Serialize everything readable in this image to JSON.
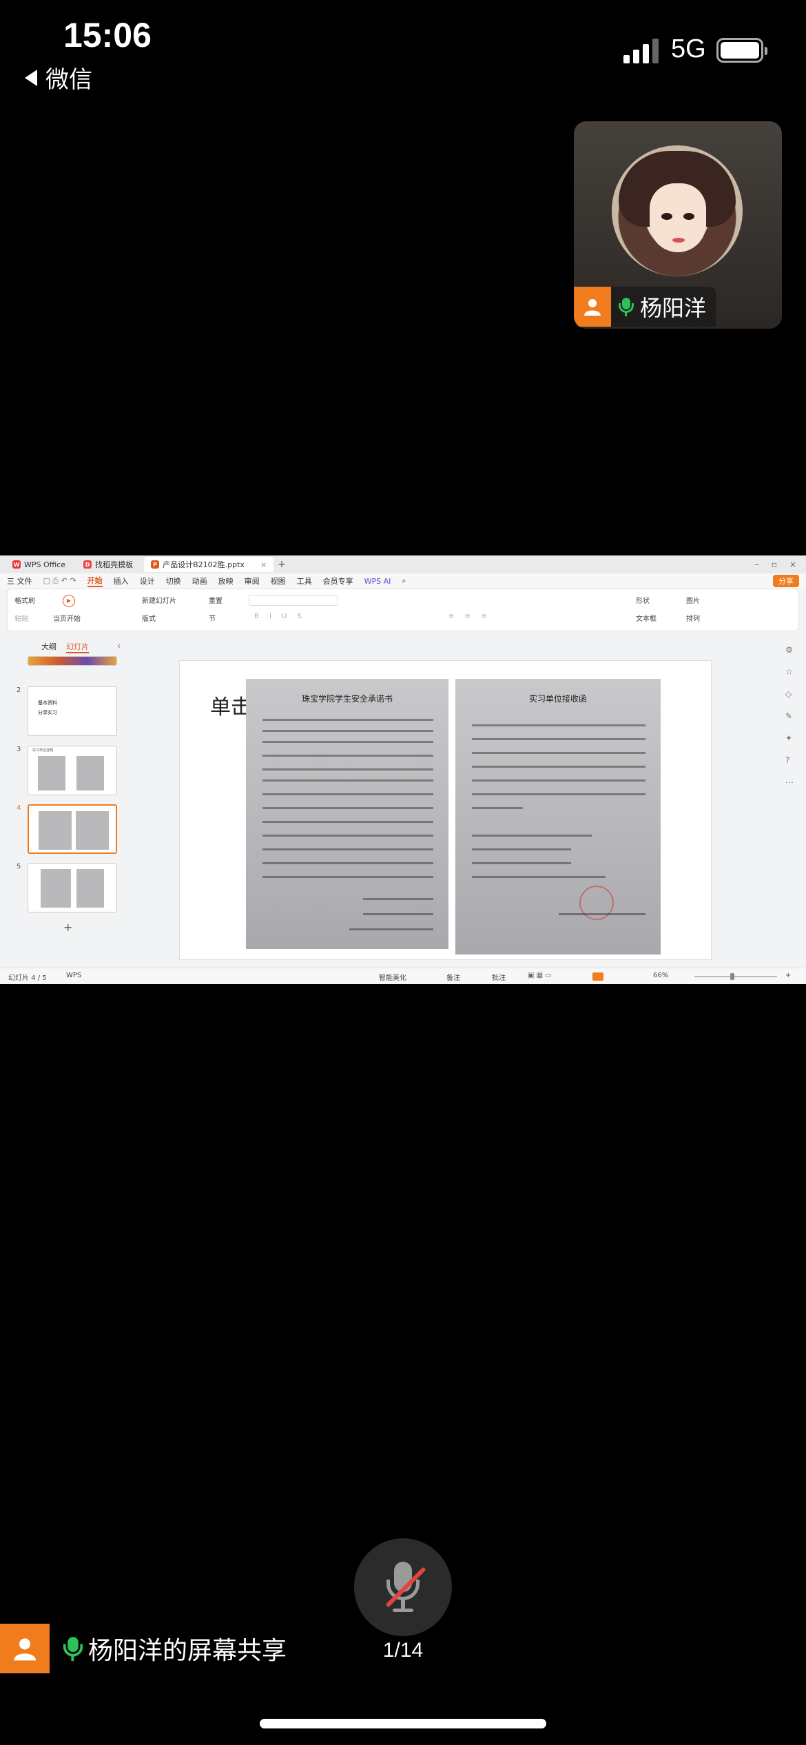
{
  "status_bar": {
    "time": "15:06",
    "network": "5G",
    "back_label": "微信"
  },
  "participant": {
    "name": "杨阳洋"
  },
  "shared_screen": {
    "tabs": [
      {
        "label": "WPS Office"
      },
      {
        "label": "找稻壳模板"
      },
      {
        "label": "产品设计B2102胜.pptx"
      }
    ],
    "menu": {
      "file": "三 文件",
      "items": [
        "开始",
        "插入",
        "设计",
        "切换",
        "动画",
        "放映",
        "审阅",
        "视图",
        "工具",
        "会员专享"
      ],
      "wps_ai": "WPS AI",
      "share": "分享"
    },
    "ribbon": {
      "format_painter": "格式刷",
      "paste": "粘贴",
      "play_from_current": "当页开始",
      "new_slide": "新建幻灯片",
      "layout": "版式",
      "reset": "重置",
      "section": "节",
      "shape": "形状",
      "picture": "图片",
      "textbox": "文本框",
      "arrange": "排列"
    },
    "panel": {
      "outline_tab": "大纲",
      "slides_tab": "幻灯片",
      "thumb2_line1": "基本资料",
      "thumb2_line2": "分享实习",
      "thumb3_caption": "实习单位证明",
      "numbers": [
        "2",
        "3",
        "4",
        "5"
      ],
      "add": "+"
    },
    "slide": {
      "title": "单击",
      "doc_left_title": "珠宝学院学生安全承诺书",
      "doc_right_title": "实习单位接收函"
    },
    "statusbar": {
      "slide_count": "幻灯片 4 / 5",
      "app": "WPS",
      "beautify": "智能美化",
      "notes": "备注",
      "comment": "批注",
      "zoom": "66%"
    }
  },
  "footer": {
    "page_indicator": "1/14",
    "share_label": "杨阳洋的屏幕共享"
  },
  "colors": {
    "accent_orange": "#f07c1e",
    "mic_green": "#2ec05b",
    "mute_red": "#e0463c"
  }
}
